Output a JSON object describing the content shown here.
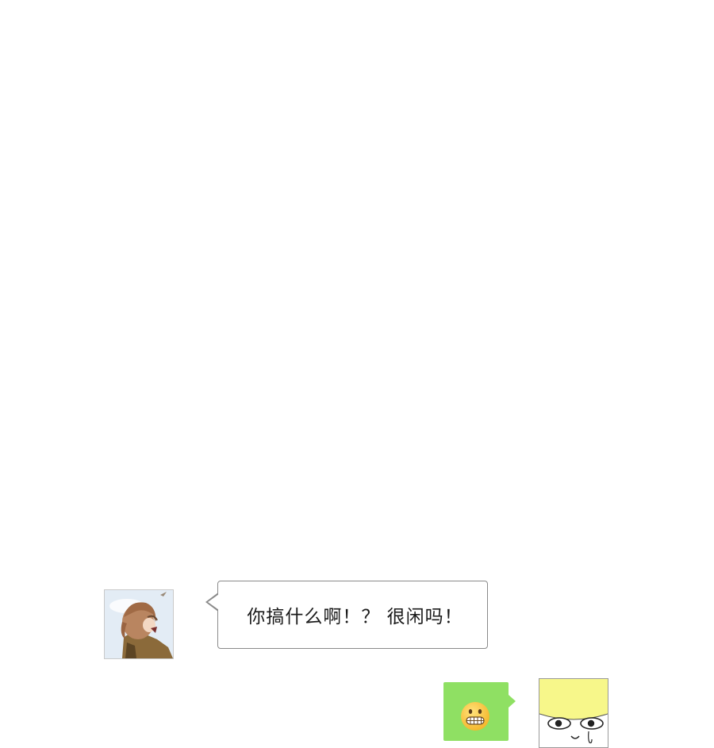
{
  "messages": [
    {
      "sender": "other",
      "avatar_icon": "character-avatar-icon",
      "text": "你搞什么啊！？ 很闲吗！"
    },
    {
      "sender": "self",
      "content_icon": "grimacing-face-emoji-icon",
      "avatar_icon": "yellow-face-avatar-icon",
      "bubble_color": "#8fe063"
    }
  ]
}
